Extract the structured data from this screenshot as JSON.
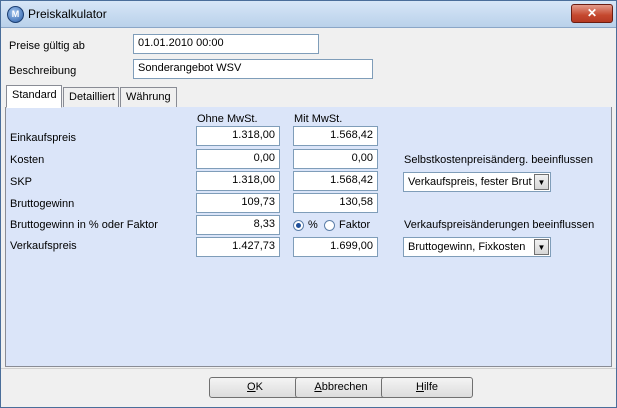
{
  "window": {
    "title": "Preiskalkulator",
    "close_label": "✕"
  },
  "header": {
    "valid_from_label": "Preise gültig ab",
    "valid_from_value": "01.01.2010 00:00",
    "description_label": "Beschreibung",
    "description_value": "Sonderangebot WSV"
  },
  "tabs": [
    {
      "label": "Standard",
      "active": true
    },
    {
      "label": "Detailliert",
      "active": false
    },
    {
      "label": "Währung",
      "active": false
    }
  ],
  "standard": {
    "col_net": "Ohne MwSt.",
    "col_gross": "Mit MwSt.",
    "rows": [
      {
        "label": "Einkaufspreis",
        "net": "1.318,00",
        "gross": "1.568,42"
      },
      {
        "label": "Kosten",
        "net": "0,00",
        "gross": "0,00"
      },
      {
        "label": "SKP",
        "net": "1.318,00",
        "gross": "1.568,42"
      },
      {
        "label": "Bruttogewinn",
        "net": "109,73",
        "gross": "130,58"
      },
      {
        "label": "Bruttogewinn in % oder Faktor",
        "net": "8,33"
      },
      {
        "label": "Verkaufspreis",
        "net": "1.427,73",
        "gross": "1.699,00"
      }
    ],
    "radio_percent_label": "%",
    "radio_factor_label": "Faktor",
    "radio_selected": "percent",
    "skp_influence_label": "Selbstkostenpreisänderg. beeinflussen",
    "skp_influence_value": "Verkaufspreis, fester Brutto",
    "vk_influence_label": "Verkaufspreisänderungen beeinflussen",
    "vk_influence_value": "Bruttogewinn, Fixkosten"
  },
  "buttons": {
    "ok_mnemonic": "O",
    "ok_rest": "K",
    "cancel_mnemonic": "A",
    "cancel_rest": "bbrechen",
    "help_mnemonic": "H",
    "help_rest": "ilfe"
  },
  "colors": {
    "panel_bg": "#dbe5f9",
    "title_gradient_top": "#d7e6f7",
    "close_button": "#c5482f"
  },
  "icons": {
    "app": "app-logo-icon",
    "close": "close-icon",
    "dropdown": "chevron-down-icon"
  }
}
